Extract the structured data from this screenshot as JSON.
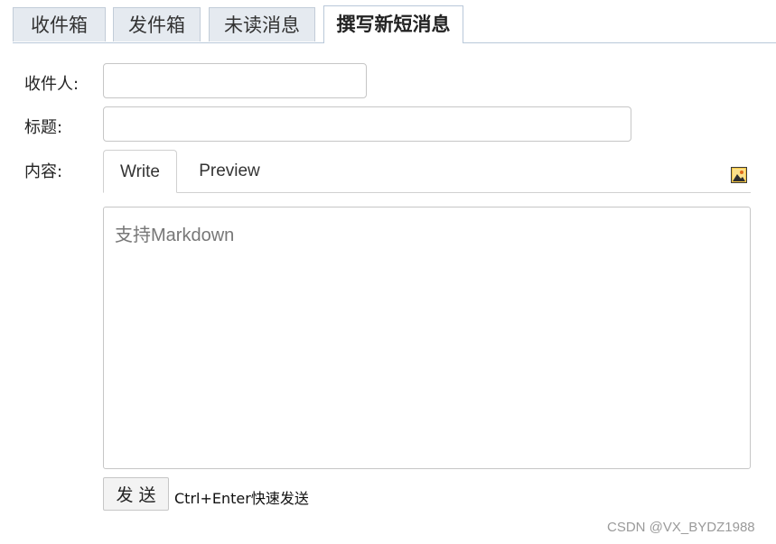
{
  "tabs": [
    {
      "label": "收件箱",
      "active": false
    },
    {
      "label": "发件箱",
      "active": false
    },
    {
      "label": "未读消息",
      "active": false
    },
    {
      "label": "撰写新短消息",
      "active": true
    }
  ],
  "form": {
    "recipient_label": "收件人:",
    "recipient_value": "",
    "subject_label": "标题:",
    "subject_value": "",
    "content_label": "内容:",
    "content_placeholder": "支持Markdown",
    "content_value": ""
  },
  "editor_tabs": {
    "write": "Write",
    "preview": "Preview",
    "active": "write"
  },
  "toolbar": {
    "image_icon": "insert-image-icon"
  },
  "actions": {
    "send_label": "发 送",
    "send_hint": "Ctrl+Enter快速发送"
  },
  "watermark": "CSDN @VX_BYDZ1988",
  "colors": {
    "tab_inactive_bg": "#e5eaf0",
    "tab_border": "#b9c8d9",
    "input_border": "#c6c6c6",
    "button_bg": "#f3f3f3"
  }
}
